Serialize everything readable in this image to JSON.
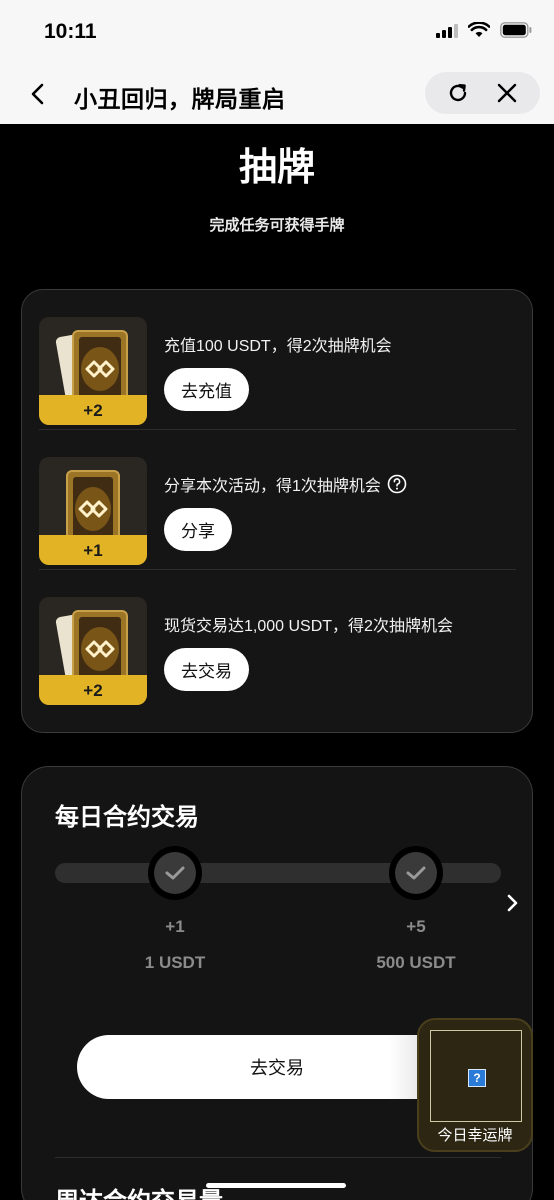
{
  "status_bar": {
    "time": "10:11"
  },
  "nav": {
    "title": "小丑回归，牌局重启"
  },
  "header": {
    "title": "抽牌",
    "subtitle": "完成任务可获得手牌"
  },
  "tasks": [
    {
      "reward": "+2",
      "text": "充值100 USDT，得2次抽牌机会",
      "button": "去充值"
    },
    {
      "reward": "+1",
      "text": "分享本次活动，得1次抽牌机会",
      "button": "分享"
    },
    {
      "reward": "+2",
      "text": "现货交易达1,000 USDT，得2次抽牌机会",
      "button": "去交易"
    }
  ],
  "daily": {
    "title": "每日合约交易",
    "milestones": [
      {
        "reward": "+1",
        "label": "1 USDT"
      },
      {
        "reward": "+5",
        "label": "500 USDT"
      }
    ],
    "button": "去交易"
  },
  "weekly": {
    "title": "周达合约交易量"
  },
  "lucky": {
    "label": "今日幸运牌",
    "badge": "?"
  },
  "colors": {
    "accent": "#e2b325",
    "background": "#000000",
    "card": "#151515"
  }
}
